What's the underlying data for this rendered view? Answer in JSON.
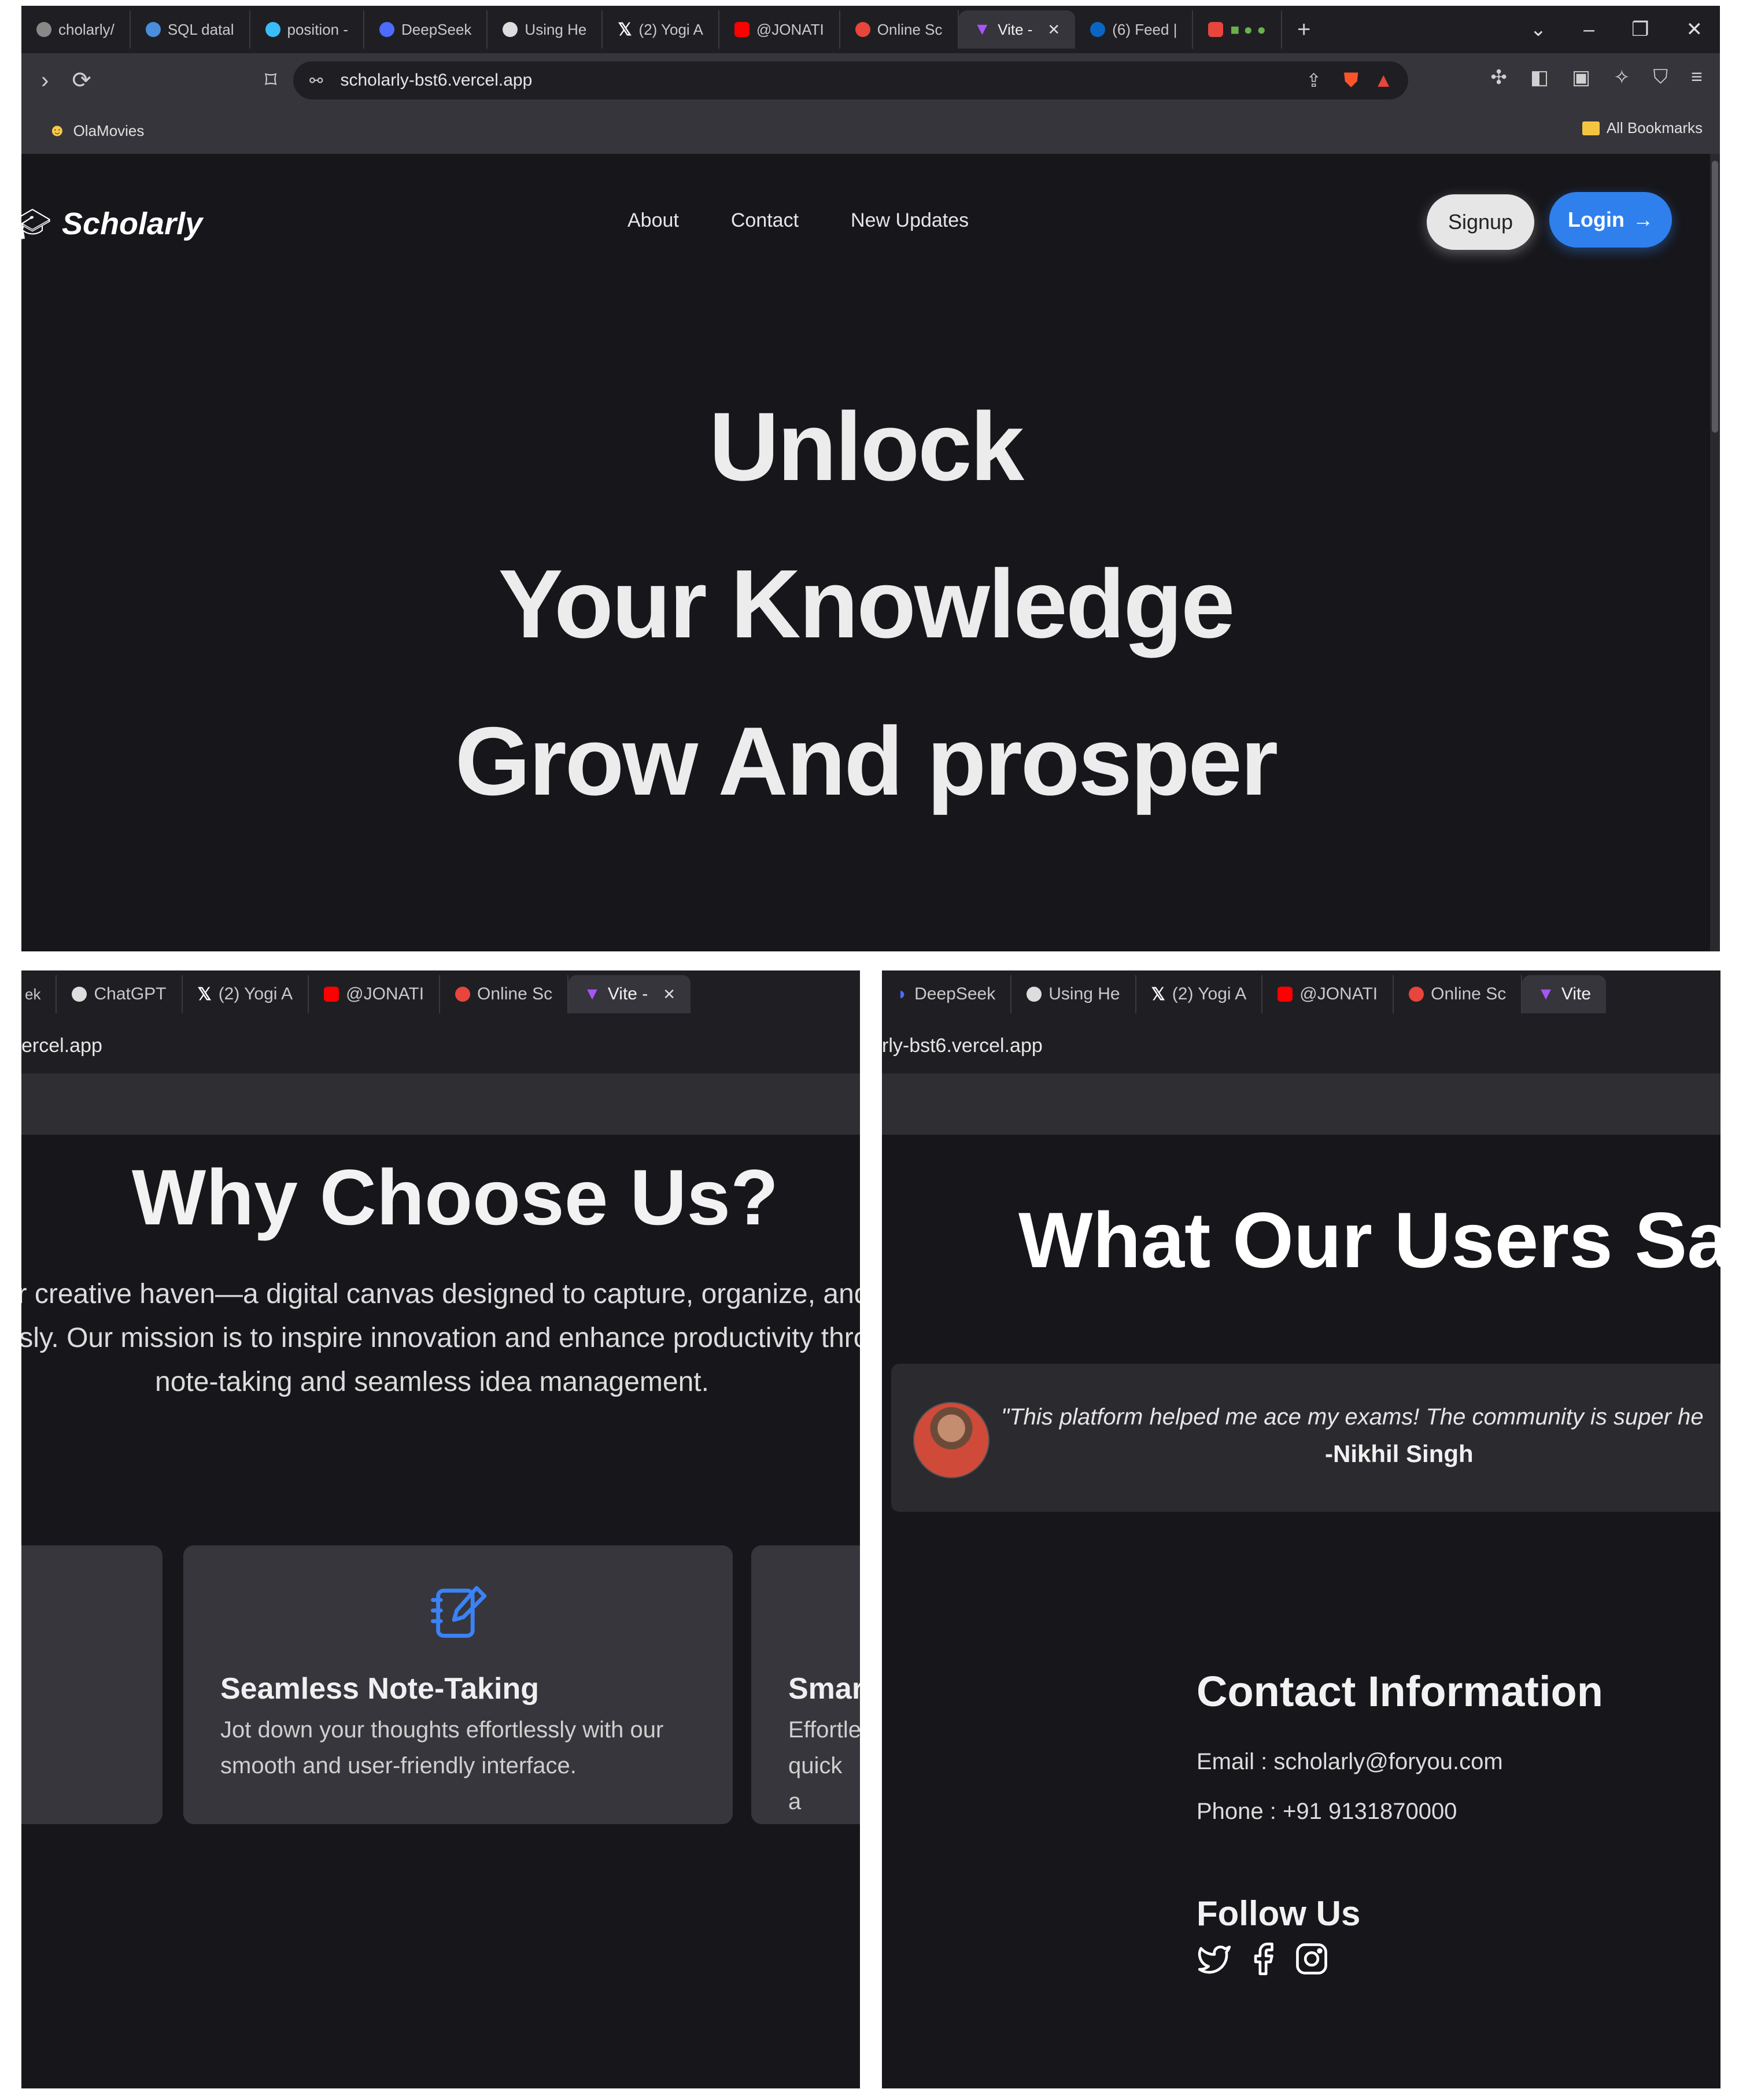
{
  "screenshot_top": {
    "tabs": [
      {
        "label": "cholarly/",
        "color": "#888888"
      },
      {
        "label": "SQL datal",
        "color": "#4a8ddc"
      },
      {
        "label": "position -",
        "color": "#38bdf8"
      },
      {
        "label": "DeepSeek",
        "color": "#4d6bfe"
      },
      {
        "label": "Using He",
        "color": "#dddddd"
      },
      {
        "label": "(2) Yogi A",
        "color": "#ffffff"
      },
      {
        "label": "@JONATI",
        "color": "#ff0000"
      },
      {
        "label": "Online Sc",
        "color": "#e8453c"
      },
      {
        "label": "Vite -",
        "color": "#a855f7",
        "active": true
      },
      {
        "label": "(6) Feed |",
        "color": "#0a66c2"
      }
    ],
    "url": "scholarly-bst6.vercel.app",
    "bookmark": "OlaMovies",
    "all_bookmarks": "All Bookmarks",
    "site": {
      "brand": "Scholarly",
      "nav": [
        "About",
        "Contact",
        "New Updates"
      ],
      "signup": "Signup",
      "login": "Login",
      "hero_lines": [
        "Unlock",
        "Your Knowledge",
        "Grow And prosper"
      ]
    }
  },
  "screenshot_left": {
    "tabs": [
      {
        "label": "ek",
        "color": "#888888"
      },
      {
        "label": "ChatGPT",
        "color": "#dddddd"
      },
      {
        "label": "(2) Yogi A",
        "color": "#ffffff"
      },
      {
        "label": "@JONATI",
        "color": "#ff0000"
      },
      {
        "label": "Online Sc",
        "color": "#e8453c"
      },
      {
        "label": "Vite -",
        "color": "#a855f7",
        "active": true
      }
    ],
    "url": "ercel.app",
    "section_title": "Why Choose Us?",
    "section_text": "Scholarly is your creative haven—a digital canvas designed to capture, organize, and cultivate your ideas effortlessly. Our mission is to inspire innovation and enhance productivity through intuitive note-taking and seamless idea management.",
    "card_mid": {
      "title": "Seamless Note-Taking",
      "description": "Jot down your thoughts effortlessly with our smooth and user-friendly interface."
    },
    "card_right": {
      "title": "Smar",
      "description": "Effortle quick a"
    }
  },
  "screenshot_right": {
    "tabs": [
      {
        "label": "DeepSeek",
        "color": "#4d6bfe"
      },
      {
        "label": "Using He",
        "color": "#dddddd"
      },
      {
        "label": "(2) Yogi A",
        "color": "#ffffff"
      },
      {
        "label": "@JONATI",
        "color": "#ff0000"
      },
      {
        "label": "Online Sc",
        "color": "#e8453c"
      },
      {
        "label": "Vite",
        "color": "#a855f7",
        "active": true
      }
    ],
    "url": "rly-bst6.vercel.app",
    "testimonials_title": "What Our Users Sa",
    "testimonial": {
      "quote": "\"This platform helped me ace my exams! The community is super he",
      "author": "-Nikhil Singh"
    },
    "contact": {
      "title": "Contact Information",
      "email": "Email : scholarly@foryou.com",
      "phone": "Phone : +91 9131870000"
    },
    "follow_title": "Follow Us",
    "socials": [
      "twitter-icon",
      "facebook-icon",
      "instagram-icon"
    ]
  }
}
